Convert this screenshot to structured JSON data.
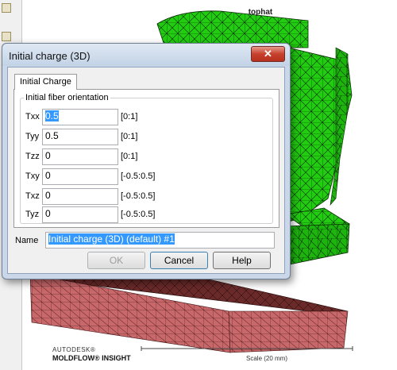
{
  "model": {
    "title": "tophat",
    "brand_line1": "AUTODESK®",
    "brand_line2": "MOLDFLOW® INSIGHT",
    "scale_label": "Scale (20 mm)",
    "colors": {
      "green_part": "#22cc11",
      "red_part": "#c9686a",
      "mesh": "#111111"
    }
  },
  "dialog": {
    "title": "Initial charge (3D)",
    "close_label": "✕",
    "tab_label": "Initial Charge",
    "group_label": "Initial fiber orientation",
    "fields": [
      {
        "label": "Txx",
        "value": "0.5",
        "range": "[0:1]"
      },
      {
        "label": "Tyy",
        "value": "0.5",
        "range": "[0:1]"
      },
      {
        "label": "Tzz",
        "value": "0",
        "range": "[0:1]"
      },
      {
        "label": "Txy",
        "value": "0",
        "range": "[-0.5:0.5]"
      },
      {
        "label": "Txz",
        "value": "0",
        "range": "[-0.5:0.5]"
      },
      {
        "label": "Tyz",
        "value": "0",
        "range": "[-0.5:0.5]"
      }
    ],
    "name_label": "Name",
    "name_value": "Initial charge (3D) (default) #1",
    "buttons": {
      "ok": "OK",
      "cancel": "Cancel",
      "help": "Help"
    }
  }
}
